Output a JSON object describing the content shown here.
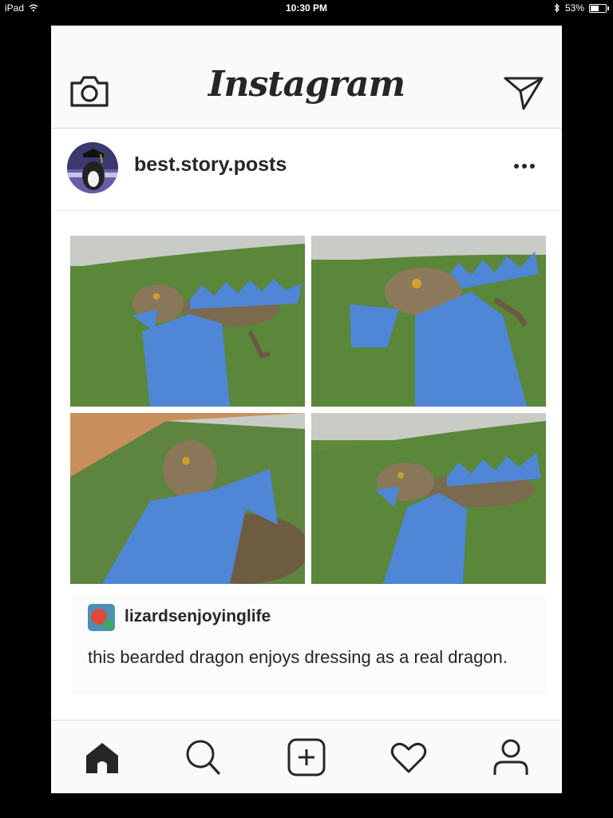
{
  "status_bar": {
    "device": "iPad",
    "time": "10:30 PM",
    "battery": "53%",
    "battery_level": 0.53
  },
  "header": {
    "logo": "Instagram",
    "left_icon": "camera-icon",
    "right_icon": "direct-send-icon"
  },
  "post": {
    "username": "best.story.posts",
    "options_icon": "more-options-icon",
    "image": {
      "panels": [
        "lizard-photo-1",
        "lizard-photo-2",
        "lizard-photo-3",
        "lizard-photo-4"
      ],
      "caption_user": "lizardsenjoyinglife",
      "caption_text": "this bearded dragon enjoys dressing as a real dragon."
    }
  },
  "tab_bar": {
    "items": [
      "home-icon",
      "search-icon",
      "new-post-icon",
      "activity-heart-icon",
      "profile-icon"
    ]
  },
  "colors": {
    "text": "#262626",
    "border": "#dbdbdb",
    "header_bg": "#fafafa"
  }
}
